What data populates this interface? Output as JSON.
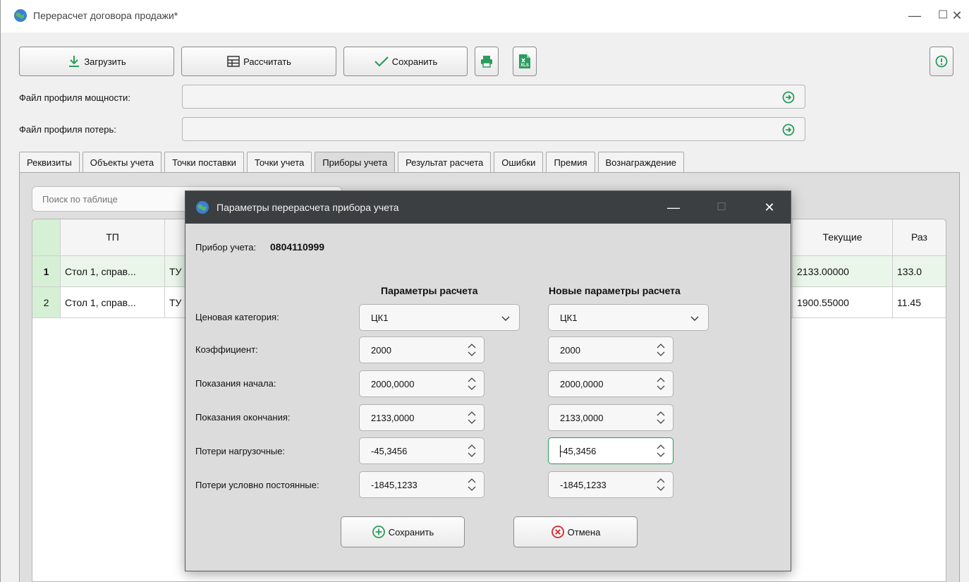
{
  "window": {
    "title": "Перерасчет договора продажи*",
    "controls": {
      "minimize": "—",
      "maximize": "☐",
      "close": "✕"
    }
  },
  "toolbar": {
    "load_label": "Загрузить",
    "calculate_label": "Рассчитать",
    "save_label": "Сохранить",
    "excel_badge": "XLS"
  },
  "files": {
    "power_profile_label": "Файл профиля мощности:",
    "loss_profile_label": "Файл профиля потерь:"
  },
  "tabs": [
    {
      "label": "Реквизиты"
    },
    {
      "label": "Объекты учета"
    },
    {
      "label": "Точки поставки"
    },
    {
      "label": "Точки учета"
    },
    {
      "label": "Приборы учета",
      "active": true
    },
    {
      "label": "Результат расчета"
    },
    {
      "label": "Ошибки"
    },
    {
      "label": "Премия"
    },
    {
      "label": "Вознаграждение"
    }
  ],
  "search": {
    "placeholder": "Поиск по таблице"
  },
  "table": {
    "headers": {
      "tp": "ТП",
      "current": "Текущие",
      "diff": "Раз"
    },
    "rows": [
      {
        "num": "1",
        "tp": "Стол 1, справ...",
        "col2": "ТУ",
        "current": "2133.00000",
        "diff": "133.0"
      },
      {
        "num": "2",
        "tp": "Стол 1, справ...",
        "col2": "ТУ",
        "current": "1900.55000",
        "diff": "11.45"
      }
    ]
  },
  "dialog": {
    "title": "Параметры перерасчета прибора учета",
    "controls": {
      "minimize": "—",
      "maximize": "☐",
      "close": "✕"
    },
    "device_label": "Прибор учета:",
    "device_number": "0804110999",
    "col_current": "Параметры расчета",
    "col_new": "Новые параметры расчета",
    "fields": {
      "price_category": {
        "label": "Ценовая категория:",
        "current": "ЦК1",
        "new": "ЦК1"
      },
      "coefficient": {
        "label": "Коэффициент:",
        "current": "2000",
        "new": "2000"
      },
      "start_reading": {
        "label": "Показания начала:",
        "current": "2000,0000",
        "new": "2000,0000"
      },
      "end_reading": {
        "label": "Показания окончания:",
        "current": "2133,0000",
        "new": "2133,0000"
      },
      "load_losses": {
        "label": "Потери нагрузочные:",
        "current": "-45,3456",
        "new": "-45,3456"
      },
      "const_losses": {
        "label": "Потери условно постоянные:",
        "current": "-1845,1233",
        "new": "-1845,1233"
      }
    },
    "save_label": "Сохранить",
    "cancel_label": "Отмена"
  },
  "colors": {
    "accent_green": "#2a9d5c",
    "row_number_bg": "#d6f0d6",
    "dialog_titlebar": "#3c3f41",
    "cancel_red": "#d9262c"
  }
}
